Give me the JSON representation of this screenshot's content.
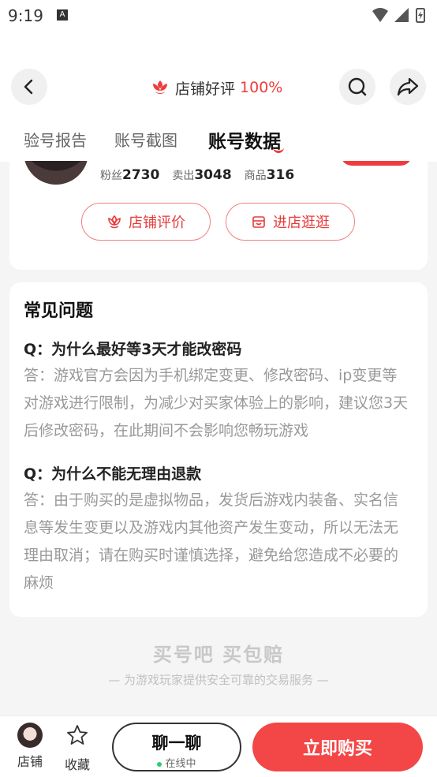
{
  "status_bar": {
    "time": "9:19"
  },
  "header": {
    "shop_rating_label": "店铺好评",
    "shop_rating_value": "100%"
  },
  "tabs": [
    {
      "label": "验号报告"
    },
    {
      "label": "账号截图"
    },
    {
      "label": "账号数据",
      "active": true
    }
  ],
  "shop": {
    "fans_label": "粉丝",
    "fans_value": "2730",
    "sold_label": "卖出",
    "sold_value": "3048",
    "goods_label": "商品",
    "goods_value": "316",
    "review_button": "店铺评价",
    "visit_button": "进店逛逛"
  },
  "faq": {
    "title": "常见问题",
    "items": [
      {
        "q": "Q：为什么最好等3天才能改密码",
        "a": "答：游戏官方会因为手机绑定变更、修改密码、ip变更等对游戏进行限制，为减少对买家体验上的影响，建议您3天后修改密码，在此期间不会影响您畅玩游戏"
      },
      {
        "q": "Q：为什么不能无理由退款",
        "a": "答：由于购买的是虚拟物品，发货后游戏内装备、实名信息等发生变更以及游戏内其他资产发生变动，所以无法无理由取消；请在购买时谨慎选择，避免给您造成不必要的麻烦"
      }
    ]
  },
  "brand": {
    "logo_left": "买号吧",
    "logo_right": "买包赔",
    "slogan": "— 为游戏玩家提供安全可靠的交易服务 —"
  },
  "bottom_bar": {
    "shop_label": "店铺",
    "fav_label": "收藏",
    "chat_label": "聊一聊",
    "online_label": "在线中",
    "buy_label": "立即购买"
  },
  "colors": {
    "accent": "#f03c3c",
    "buy": "#f34646",
    "online": "#2ecc71"
  }
}
